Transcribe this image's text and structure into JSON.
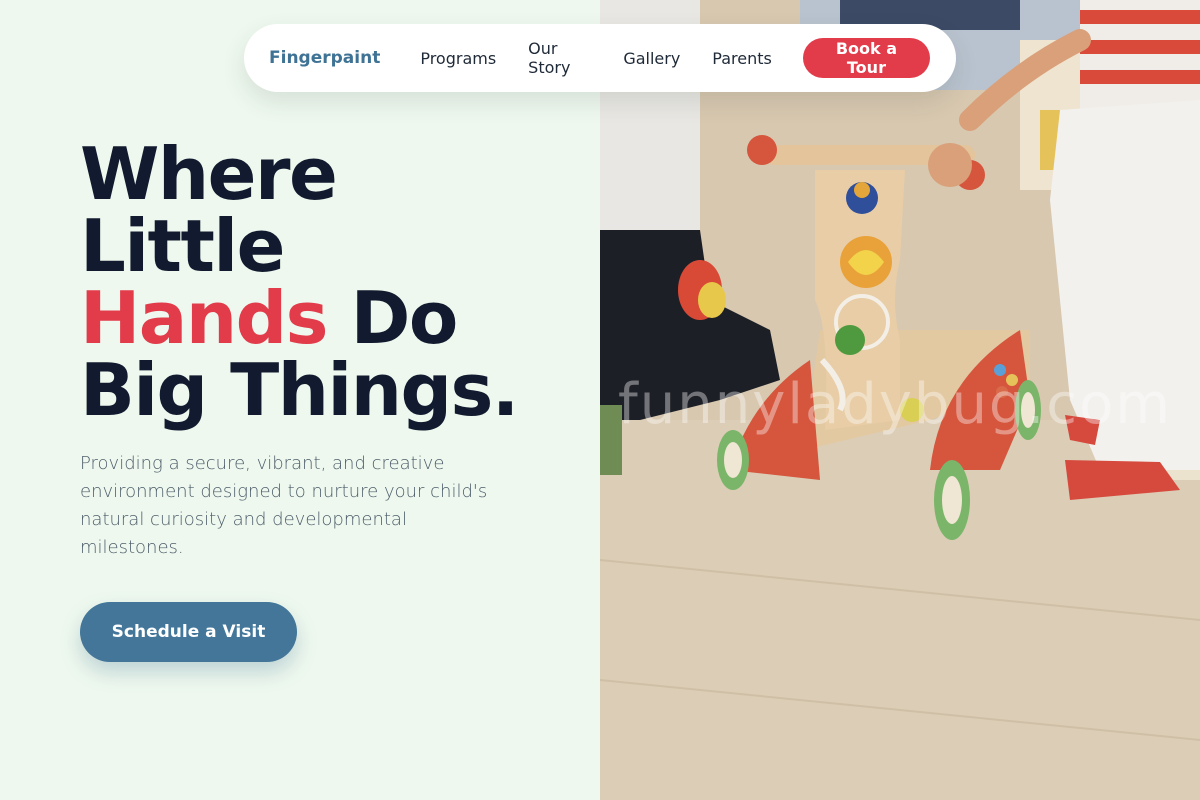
{
  "nav": {
    "brand": "Fingerpaint",
    "links": [
      "Programs",
      "Our Story",
      "Gallery",
      "Parents"
    ],
    "cta": "Book a Tour"
  },
  "hero": {
    "title_line1": "Where",
    "title_line2": "Little",
    "title_accent": "Hands",
    "title_line3_rest": " Do",
    "title_line4": "Big Things.",
    "subtitle": "Providing a secure, vibrant, and creative environment designed to nurture your child's natural curiosity and developmental milestones.",
    "cta": "Schedule a Visit"
  },
  "photo": {
    "watermark": "funnyladybug.com"
  },
  "colors": {
    "background": "#eef8ee",
    "brand": "#3f7395",
    "accent_red": "#e23b4a",
    "heading": "#111a2e",
    "cta_blue": "#437698"
  }
}
